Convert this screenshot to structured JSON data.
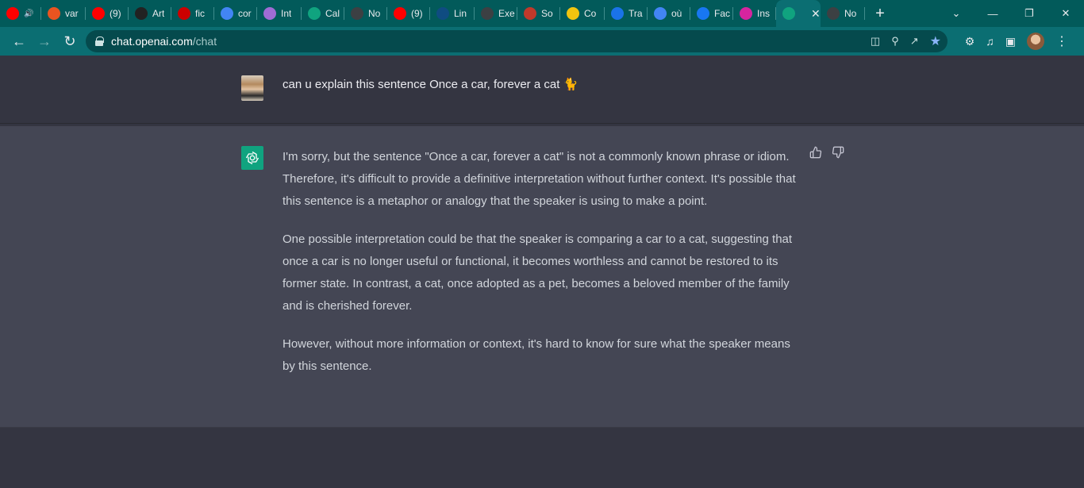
{
  "tabs": [
    {
      "title": "",
      "favicon": "youtube-icon",
      "audio": true,
      "color": "#ff0000"
    },
    {
      "title": "var",
      "favicon": "ubuntu-icon",
      "color": "#e95420"
    },
    {
      "title": "(9)",
      "favicon": "youtube-icon",
      "color": "#ff0000"
    },
    {
      "title": "Art",
      "favicon": "artstation-icon",
      "color": "#222222"
    },
    {
      "title": "fic",
      "favicon": "flash-icon",
      "color": "#cc0000"
    },
    {
      "title": "cor",
      "favicon": "google-icon",
      "color": "#4285f4"
    },
    {
      "title": "Int",
      "favicon": "dribbble-icon",
      "color": "#a06cd5"
    },
    {
      "title": "Cal",
      "favicon": "openai-icon",
      "color": "#10a37f"
    },
    {
      "title": "No",
      "favicon": "chrome-icon",
      "color": "#3c4043"
    },
    {
      "title": "(9)",
      "favicon": "youtube-icon",
      "color": "#ff0000"
    },
    {
      "title": "Lin",
      "favicon": "linguee-icon",
      "color": "#0f4c81"
    },
    {
      "title": "Exe",
      "favicon": "chrome-icon",
      "color": "#3c4043"
    },
    {
      "title": "So",
      "favicon": "cart-icon",
      "color": "#c0392b"
    },
    {
      "title": "Co",
      "favicon": "coursehero-icon",
      "color": "#f1c40f"
    },
    {
      "title": "Tra",
      "favicon": "contacts-icon",
      "color": "#1a73e8"
    },
    {
      "title": "où",
      "favicon": "google-icon",
      "color": "#4285f4"
    },
    {
      "title": "Fac",
      "favicon": "facebook-icon",
      "color": "#1877f2"
    },
    {
      "title": "Ins",
      "favicon": "instagram-icon",
      "color": "#d6249f"
    },
    {
      "title": "",
      "favicon": "openai-icon",
      "active": true,
      "color": "#10a37f"
    },
    {
      "title": "No",
      "favicon": "chrome-icon",
      "color": "#3c4043"
    }
  ],
  "omnibox": {
    "host": "chat.openai.com",
    "path": "/chat"
  },
  "conversation": {
    "user_message": "can u explain this sentence Once a car, forever a cat 🐈",
    "assistant_paragraphs": [
      "I'm sorry, but the sentence \"Once a car, forever a cat\" is not a commonly known phrase or idiom. Therefore, it's difficult to provide a definitive interpretation without further context. It's possible that this sentence is a metaphor or analogy that the speaker is using to make a point.",
      "One possible interpretation could be that the speaker is comparing a car to a cat, suggesting that once a car is no longer useful or functional, it becomes worthless and cannot be restored to its former state. In contrast, a cat, once adopted as a pet, becomes a beloved member of the family and is cherished forever.",
      "However, without more information or context, it's hard to know for sure what the speaker means by this sentence."
    ]
  },
  "colors": {
    "tab_strip": "#025a5a",
    "toolbar": "#0b6e72",
    "user_row": "#343541",
    "assistant_row": "#444654",
    "gpt_green": "#10a37f"
  }
}
